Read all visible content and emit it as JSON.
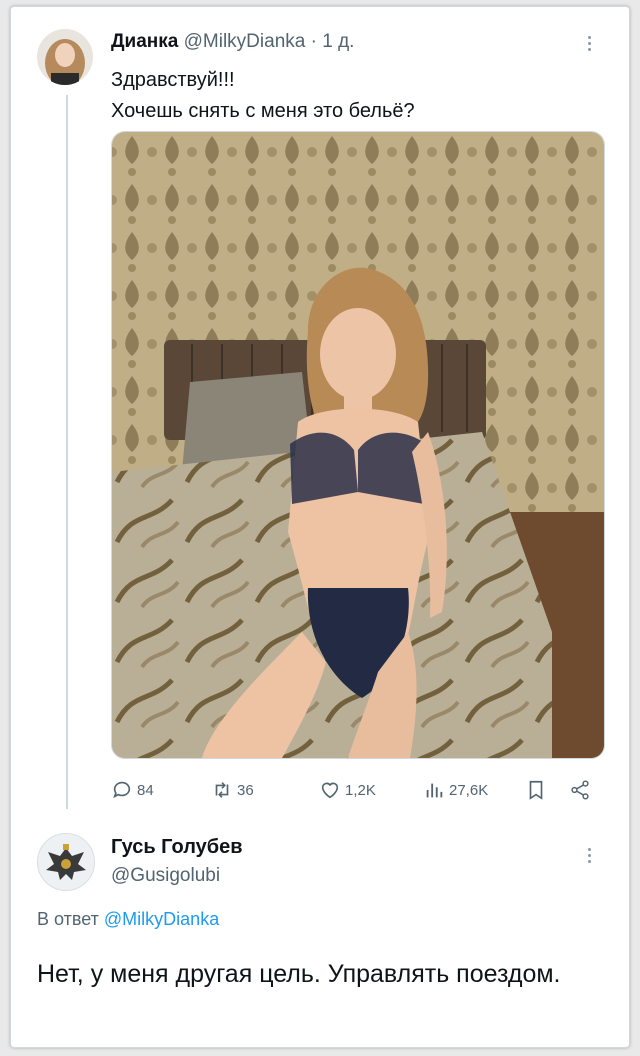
{
  "tweet": {
    "author_name": "Дианка",
    "author_handle": "@MilkyDianka",
    "separator": "·",
    "time": "1 д.",
    "text_line1": "Здравствуй!!!",
    "text_line2": "Хочешь снять с меня это бельё?",
    "stats": {
      "replies": "84",
      "retweets": "36",
      "likes": "1,2K",
      "views": "27,6K"
    }
  },
  "reply": {
    "author_name": "Гусь Голубев",
    "author_handle": "@Gusigolubi",
    "replying_prefix": "В ответ",
    "replying_mention": "@MilkyDianka",
    "text": "Нет, у меня другая цель. Управлять поездом."
  },
  "icons": {
    "reply": "speech-bubble-icon",
    "retweet": "retweet-icon",
    "like": "heart-icon",
    "views": "bar-chart-icon",
    "bookmark": "bookmark-icon",
    "share": "share-icon",
    "more": "more-dots-icon"
  },
  "colors": {
    "accent": "#1d9bf0",
    "muted": "#536471",
    "text": "#0f1419",
    "border": "#cfd9de"
  }
}
